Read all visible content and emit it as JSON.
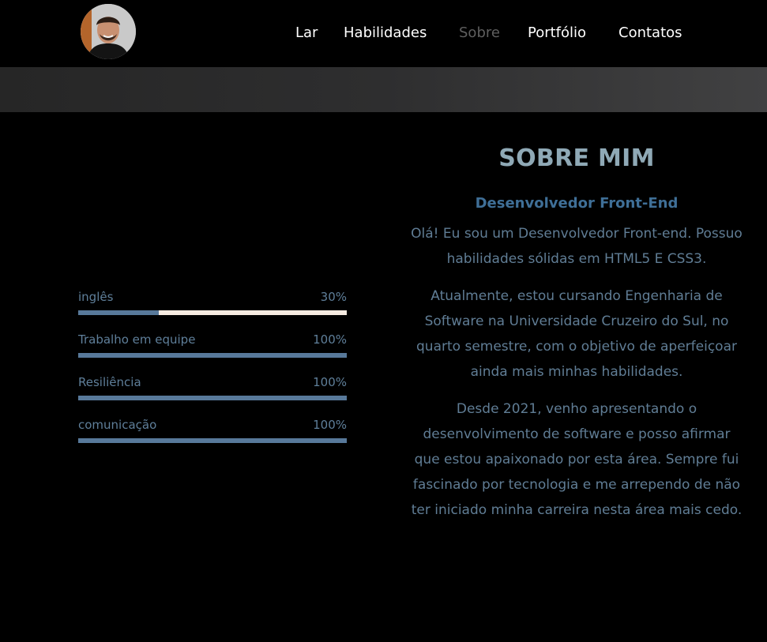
{
  "nav": {
    "links": [
      {
        "label": "Lar",
        "active": false
      },
      {
        "label": "Habilidades",
        "active": false
      },
      {
        "label": "Sobre",
        "active": true
      },
      {
        "label": "Portfólio",
        "active": false
      },
      {
        "label": "Contatos",
        "active": false
      }
    ]
  },
  "skills": [
    {
      "name": "inglês",
      "percent_label": "30%",
      "value": 30
    },
    {
      "name": "Trabalho em equipe",
      "percent_label": "100%",
      "value": 100
    },
    {
      "name": "Resiliência",
      "percent_label": "100%",
      "value": 100
    },
    {
      "name": "comunicação",
      "percent_label": "100%",
      "value": 100
    }
  ],
  "about": {
    "title": "SOBRE MIM",
    "subtitle": "Desenvolvedor Front-End",
    "paragraphs": [
      "Olá! Eu sou um Desenvolvedor Front-end. Possuo habilidades sólidas em HTML5 E CSS3.",
      "Atualmente, estou cursando Engenharia de Software na Universidade Cruzeiro do Sul, no quarto semestre, com o objetivo de aperfeiçoar ainda mais minhas habilidades.",
      "Desde 2021, venho apresentando o desenvolvimento de software e posso afirmar que estou apaixonado por esta área. Sempre fui fascinado por tecnologia e me arrependo de não ter iniciado minha carreira nesta área mais cedo."
    ]
  },
  "colors": {
    "background": "#000000",
    "nav_text": "#ffffff",
    "nav_active": "#5f5f5f",
    "skill_fill": "#58799a",
    "skill_track": "#f6ebe1",
    "title": "#8fa9b6",
    "subtitle": "#3f6f97",
    "body_text": "#607d95"
  }
}
